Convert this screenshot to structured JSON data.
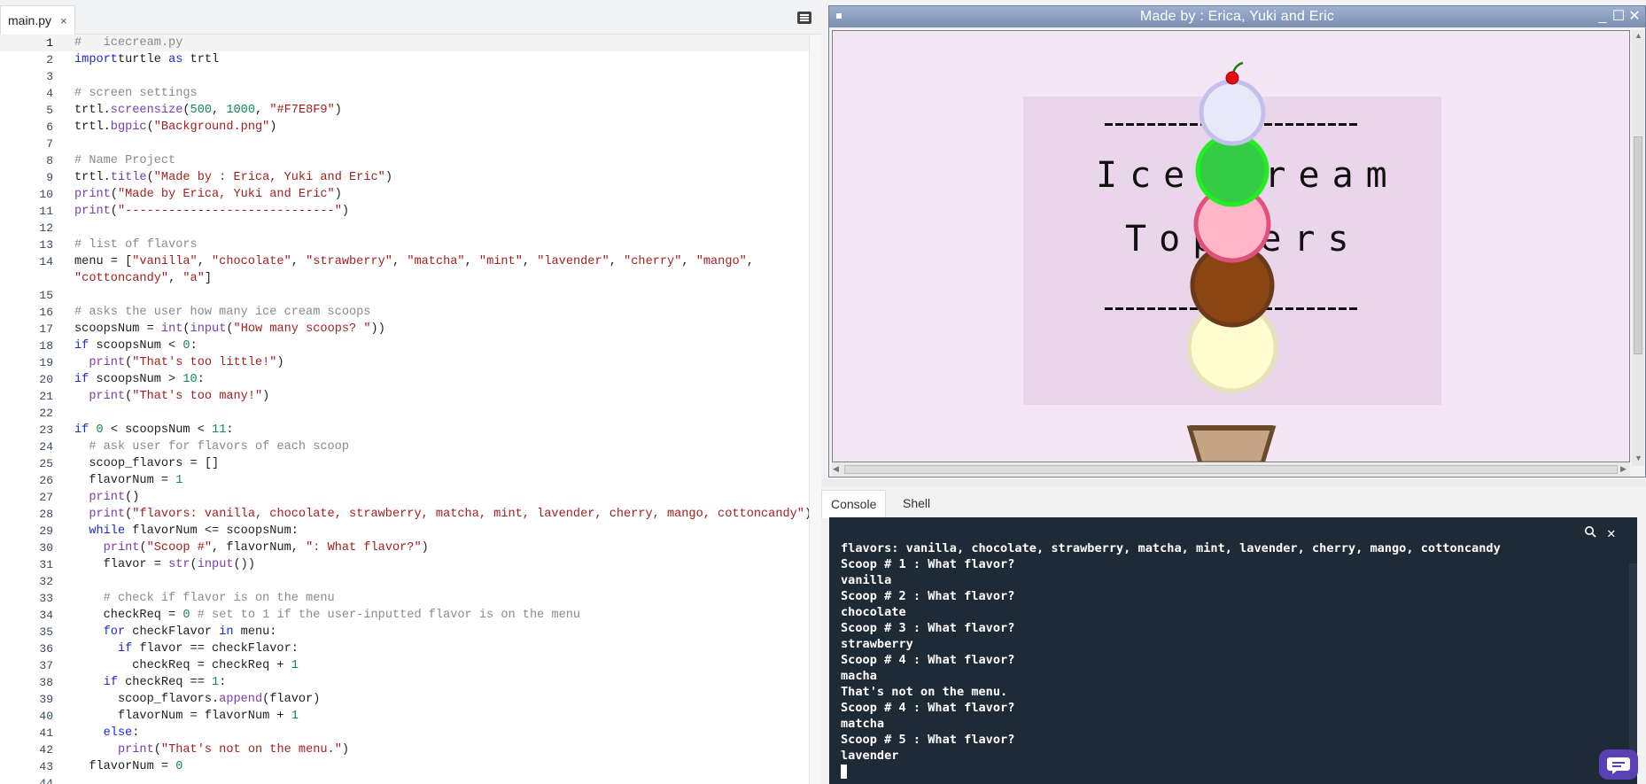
{
  "editor": {
    "tab_label": "main.py",
    "tab_close": "×",
    "active_line": 1,
    "lines": [
      {
        "n": "1",
        "t": [
          [
            "cm",
            "#   icecream.py"
          ]
        ]
      },
      {
        "n": "2",
        "t": [
          [
            "kw",
            "import"
          ],
          [
            "",
            "turtle "
          ],
          [
            "kw",
            "as"
          ],
          [
            "",
            " trtl"
          ]
        ]
      },
      {
        "n": "3",
        "t": []
      },
      {
        "n": "4",
        "t": [
          [
            "cm",
            "# screen settings"
          ]
        ]
      },
      {
        "n": "5",
        "t": [
          [
            "",
            "trtl."
          ],
          [
            "fn",
            "screensize"
          ],
          [
            "",
            "("
          ],
          [
            "num",
            "500"
          ],
          [
            "",
            ", "
          ],
          [
            "num",
            "1000"
          ],
          [
            "",
            ", "
          ],
          [
            "str",
            "\"#F7E8F9\""
          ],
          [
            "",
            ")"
          ]
        ]
      },
      {
        "n": "6",
        "t": [
          [
            "",
            "trtl."
          ],
          [
            "fn",
            "bgpic"
          ],
          [
            "",
            "("
          ],
          [
            "str",
            "\"Background.png\""
          ],
          [
            "",
            ")"
          ]
        ]
      },
      {
        "n": "7",
        "t": []
      },
      {
        "n": "8",
        "t": [
          [
            "cm",
            "# Name Project"
          ]
        ]
      },
      {
        "n": "9",
        "t": [
          [
            "",
            "trtl."
          ],
          [
            "fn",
            "title"
          ],
          [
            "",
            "("
          ],
          [
            "str",
            "\"Made by : Erica, Yuki and Eric\""
          ],
          [
            "",
            ")"
          ]
        ]
      },
      {
        "n": "10",
        "t": [
          [
            "fn",
            "print"
          ],
          [
            "",
            "("
          ],
          [
            "str",
            "\"Made by Erica, Yuki and Eric\""
          ],
          [
            "",
            ")"
          ]
        ]
      },
      {
        "n": "11",
        "t": [
          [
            "fn",
            "print"
          ],
          [
            "",
            "("
          ],
          [
            "str",
            "\"-----------------------------\""
          ],
          [
            "",
            ")"
          ]
        ]
      },
      {
        "n": "12",
        "t": []
      },
      {
        "n": "13",
        "t": [
          [
            "cm",
            "# list of flavors"
          ]
        ]
      },
      {
        "n": "14",
        "t": [
          [
            "",
            "menu = ["
          ],
          [
            "str",
            "\"vanilla\""
          ],
          [
            "",
            ", "
          ],
          [
            "str",
            "\"chocolate\""
          ],
          [
            "",
            ", "
          ],
          [
            "str",
            "\"strawberry\""
          ],
          [
            "",
            ", "
          ],
          [
            "str",
            "\"matcha\""
          ],
          [
            "",
            ", "
          ],
          [
            "str",
            "\"mint\""
          ],
          [
            "",
            ", "
          ],
          [
            "str",
            "\"lavender\""
          ],
          [
            "",
            ", "
          ],
          [
            "str",
            "\"cherry\""
          ],
          [
            "",
            ", "
          ],
          [
            "str",
            "\"mango\""
          ],
          [
            "",
            ","
          ]
        ]
      },
      {
        "n": "",
        "t": [
          [
            "str",
            "\"cottoncandy\""
          ],
          [
            "",
            ", "
          ],
          [
            "str",
            "\"a\""
          ],
          [
            "",
            "]"
          ]
        ]
      },
      {
        "n": "15",
        "t": []
      },
      {
        "n": "16",
        "t": [
          [
            "cm",
            "# asks the user how many ice cream scoops"
          ]
        ]
      },
      {
        "n": "17",
        "t": [
          [
            "",
            "scoopsNum = "
          ],
          [
            "fn",
            "int"
          ],
          [
            "",
            "("
          ],
          [
            "fn",
            "input"
          ],
          [
            "",
            "("
          ],
          [
            "str",
            "\"How many scoops? \""
          ],
          [
            "",
            "))"
          ]
        ]
      },
      {
        "n": "18",
        "t": [
          [
            "kw",
            "if"
          ],
          [
            "",
            " scoopsNum < "
          ],
          [
            "num",
            "0"
          ],
          [
            "",
            ":"
          ]
        ]
      },
      {
        "n": "19",
        "t": [
          [
            "",
            "  "
          ],
          [
            "fn",
            "print"
          ],
          [
            "",
            "("
          ],
          [
            "str",
            "\"That's too little!\""
          ],
          [
            "",
            ")"
          ]
        ]
      },
      {
        "n": "20",
        "t": [
          [
            "kw",
            "if"
          ],
          [
            "",
            " scoopsNum > "
          ],
          [
            "num",
            "10"
          ],
          [
            "",
            ":"
          ]
        ]
      },
      {
        "n": "21",
        "t": [
          [
            "",
            "  "
          ],
          [
            "fn",
            "print"
          ],
          [
            "",
            "("
          ],
          [
            "str",
            "\"That's too many!\""
          ],
          [
            "",
            ")"
          ]
        ]
      },
      {
        "n": "22",
        "t": []
      },
      {
        "n": "23",
        "t": [
          [
            "kw",
            "if"
          ],
          [
            "",
            " "
          ],
          [
            "num",
            "0"
          ],
          [
            "",
            " < scoopsNum < "
          ],
          [
            "num",
            "11"
          ],
          [
            "",
            ":"
          ]
        ]
      },
      {
        "n": "24",
        "t": [
          [
            "",
            "  "
          ],
          [
            "cm",
            "# ask user for flavors of each scoop"
          ]
        ]
      },
      {
        "n": "25",
        "t": [
          [
            "",
            "  scoop_flavors = []"
          ]
        ]
      },
      {
        "n": "26",
        "t": [
          [
            "",
            "  flavorNum = "
          ],
          [
            "num",
            "1"
          ]
        ]
      },
      {
        "n": "27",
        "t": [
          [
            "",
            "  "
          ],
          [
            "fn",
            "print"
          ],
          [
            "",
            "()"
          ]
        ]
      },
      {
        "n": "28",
        "t": [
          [
            "",
            "  "
          ],
          [
            "fn",
            "print"
          ],
          [
            "",
            "("
          ],
          [
            "str",
            "\"flavors: vanilla, chocolate, strawberry, matcha, mint, lavender, cherry, mango, cottoncandy\""
          ],
          [
            "",
            ")"
          ]
        ]
      },
      {
        "n": "29",
        "t": [
          [
            "",
            "  "
          ],
          [
            "kw",
            "while"
          ],
          [
            "",
            " flavorNum <= scoopsNum:"
          ]
        ]
      },
      {
        "n": "30",
        "t": [
          [
            "",
            "    "
          ],
          [
            "fn",
            "print"
          ],
          [
            "",
            "("
          ],
          [
            "str",
            "\"Scoop #\""
          ],
          [
            "",
            ", flavorNum, "
          ],
          [
            "str",
            "\": What flavor?\""
          ],
          [
            "",
            ")"
          ]
        ]
      },
      {
        "n": "31",
        "t": [
          [
            "",
            "    flavor = "
          ],
          [
            "fn",
            "str"
          ],
          [
            "",
            "("
          ],
          [
            "fn",
            "input"
          ],
          [
            "",
            "())"
          ]
        ]
      },
      {
        "n": "32",
        "t": []
      },
      {
        "n": "33",
        "t": [
          [
            "",
            "    "
          ],
          [
            "cm",
            "# check if flavor is on the menu"
          ]
        ]
      },
      {
        "n": "34",
        "t": [
          [
            "",
            "    checkReq = "
          ],
          [
            "num",
            "0"
          ],
          [
            "",
            " "
          ],
          [
            "cm",
            "# set to 1 if the user-inputted flavor is on the menu"
          ]
        ]
      },
      {
        "n": "35",
        "t": [
          [
            "",
            "    "
          ],
          [
            "kw",
            "for"
          ],
          [
            "",
            " checkFlavor "
          ],
          [
            "kw",
            "in"
          ],
          [
            "",
            " menu:"
          ]
        ]
      },
      {
        "n": "36",
        "t": [
          [
            "",
            "      "
          ],
          [
            "kw",
            "if"
          ],
          [
            "",
            " flavor == checkFlavor:"
          ]
        ]
      },
      {
        "n": "37",
        "t": [
          [
            "",
            "        checkReq = checkReq + "
          ],
          [
            "num",
            "1"
          ]
        ]
      },
      {
        "n": "38",
        "t": [
          [
            "",
            "    "
          ],
          [
            "kw",
            "if"
          ],
          [
            "",
            " checkReq == "
          ],
          [
            "num",
            "1"
          ],
          [
            "",
            ":"
          ]
        ]
      },
      {
        "n": "39",
        "t": [
          [
            "",
            "      scoop_flavors."
          ],
          [
            "fn",
            "append"
          ],
          [
            "",
            "(flavor)"
          ]
        ]
      },
      {
        "n": "40",
        "t": [
          [
            "",
            "      flavorNum = flavorNum + "
          ],
          [
            "num",
            "1"
          ]
        ]
      },
      {
        "n": "41",
        "t": [
          [
            "",
            "    "
          ],
          [
            "kw",
            "else"
          ],
          [
            "",
            ":"
          ]
        ]
      },
      {
        "n": "42",
        "t": [
          [
            "",
            "      "
          ],
          [
            "fn",
            "print"
          ],
          [
            "",
            "("
          ],
          [
            "str",
            "\"That's not on the menu.\""
          ],
          [
            "",
            ")"
          ]
        ]
      },
      {
        "n": "43",
        "t": [
          [
            "",
            "  flavorNum = "
          ],
          [
            "num",
            "0"
          ]
        ]
      },
      {
        "n": "44",
        "t": []
      }
    ]
  },
  "turtle_window": {
    "title": "Made by : Erica, Yuki and Eric",
    "background_words": [
      "Ice Cream",
      "Toppers"
    ],
    "canvas_color": "#F7E8F9",
    "scoops": [
      {
        "flavor": "lavender",
        "fill": "#e8e8f8",
        "outline": "#c4c0ee"
      },
      {
        "flavor": "matcha",
        "fill": "#33cc44",
        "outline": "#22ee22"
      },
      {
        "flavor": "strawberry",
        "fill": "#ffb6c8",
        "outline": "#e0507a"
      },
      {
        "flavor": "chocolate",
        "fill": "#8b4513",
        "outline": "#6b3a1a"
      },
      {
        "flavor": "vanilla",
        "fill": "#fffdd0",
        "outline": "#e8e2b8"
      }
    ]
  },
  "console": {
    "tabs": [
      "Console",
      "Shell"
    ],
    "active_tab": "Console",
    "lines": [
      "flavors: vanilla, chocolate, strawberry, matcha, mint, lavender, cherry, mango, cottoncandy",
      "Scoop # 1 : What flavor?",
      "vanilla",
      "Scoop # 2 : What flavor?",
      "chocolate",
      "Scoop # 3 : What flavor?",
      "strawberry",
      "Scoop # 4 : What flavor?",
      "macha",
      "That's not on the menu.",
      "Scoop # 4 : What flavor?",
      "matcha",
      "Scoop # 5 : What flavor?",
      "lavender"
    ]
  }
}
